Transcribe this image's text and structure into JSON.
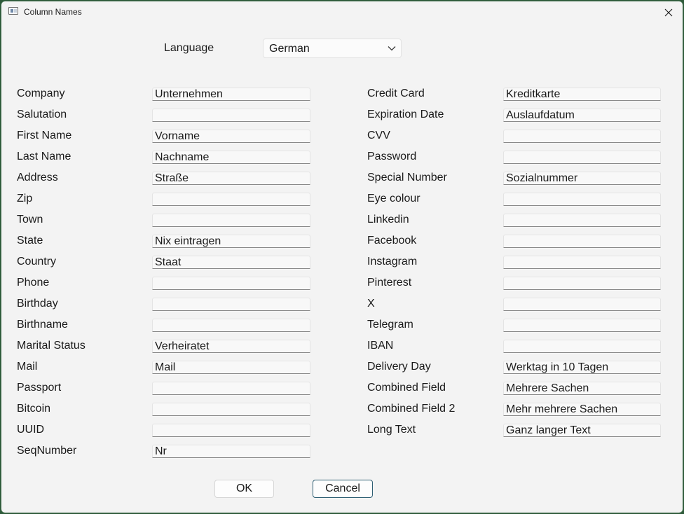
{
  "window": {
    "title": "Column Names",
    "close_glyph": "close-icon"
  },
  "language": {
    "label": "Language",
    "value": "German"
  },
  "left_fields": [
    {
      "label": "Company",
      "value": "Unternehmen"
    },
    {
      "label": "Salutation",
      "value": ""
    },
    {
      "label": "First Name",
      "value": "Vorname"
    },
    {
      "label": "Last Name",
      "value": "Nachname"
    },
    {
      "label": "Address",
      "value": "Straße"
    },
    {
      "label": "Zip",
      "value": ""
    },
    {
      "label": "Town",
      "value": ""
    },
    {
      "label": "State",
      "value": "Nix eintragen"
    },
    {
      "label": "Country",
      "value": "Staat"
    },
    {
      "label": "Phone",
      "value": ""
    },
    {
      "label": "Birthday",
      "value": ""
    },
    {
      "label": "Birthname",
      "value": ""
    },
    {
      "label": "Marital Status",
      "value": "Verheiratet"
    },
    {
      "label": "Mail",
      "value": "Mail"
    },
    {
      "label": "Passport",
      "value": ""
    },
    {
      "label": "Bitcoin",
      "value": ""
    },
    {
      "label": "UUID",
      "value": ""
    },
    {
      "label": "SeqNumber",
      "value": "Nr"
    }
  ],
  "right_fields": [
    {
      "label": "Credit Card",
      "value": "Kreditkarte"
    },
    {
      "label": "Expiration Date",
      "value": "Auslaufdatum"
    },
    {
      "label": "CVV",
      "value": ""
    },
    {
      "label": "Password",
      "value": ""
    },
    {
      "label": "Special Number",
      "value": "Sozialnummer"
    },
    {
      "label": "Eye colour",
      "value": ""
    },
    {
      "label": "Linkedin",
      "value": ""
    },
    {
      "label": "Facebook",
      "value": ""
    },
    {
      "label": "Instagram",
      "value": ""
    },
    {
      "label": "Pinterest",
      "value": ""
    },
    {
      "label": "X",
      "value": ""
    },
    {
      "label": "Telegram",
      "value": ""
    },
    {
      "label": "IBAN",
      "value": ""
    },
    {
      "label": "Delivery Day",
      "value": "Werktag in 10 Tagen"
    },
    {
      "label": "Combined Field",
      "value": "Mehrere Sachen"
    },
    {
      "label": "Combined Field 2",
      "value": "Mehr mehrere Sachen"
    },
    {
      "label": "Long Text",
      "value": "Ganz langer Text"
    }
  ],
  "buttons": {
    "ok": "OK",
    "cancel": "Cancel"
  }
}
